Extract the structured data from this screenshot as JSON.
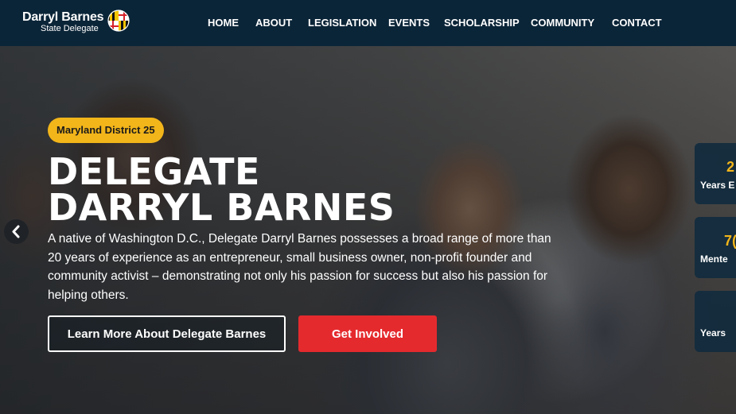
{
  "header": {
    "logo_name": "Darryl Barnes",
    "logo_subtitle": "State Delegate"
  },
  "nav": {
    "items": [
      "HOME",
      "ABOUT",
      "LEGISLATION",
      "EVENTS",
      "SCHOLARSHIP",
      "COMMUNITY",
      "CONTACT"
    ]
  },
  "hero": {
    "badge": "Maryland District 25",
    "title_line1": "DELEGATE",
    "title_line2": "DARRYL BARNES",
    "description": "A native of Washington D.C., Delegate Darryl Barnes possesses a broad range of more than 20 years of experience as an entrepreneur, small business owner, non-profit founder and community activist – demonstrating not only his passion for success but also his passion for helping others.",
    "primary_button": "Learn More About Delegate Barnes",
    "secondary_button": "Get Involved",
    "prev_arrow": "‹"
  },
  "stats": [
    {
      "number": "2",
      "label": "Years E"
    },
    {
      "number": "7(",
      "label": "Mente"
    },
    {
      "number": "",
      "label": "Years"
    }
  ],
  "colors": {
    "navbar": "#0b2538",
    "accent_yellow": "#f2b51a",
    "accent_red": "#e52a2e",
    "stat_card": "#112b3e"
  },
  "icons": {
    "logo_flag": "maryland-flag-icon",
    "prev": "chevron-left-icon"
  }
}
